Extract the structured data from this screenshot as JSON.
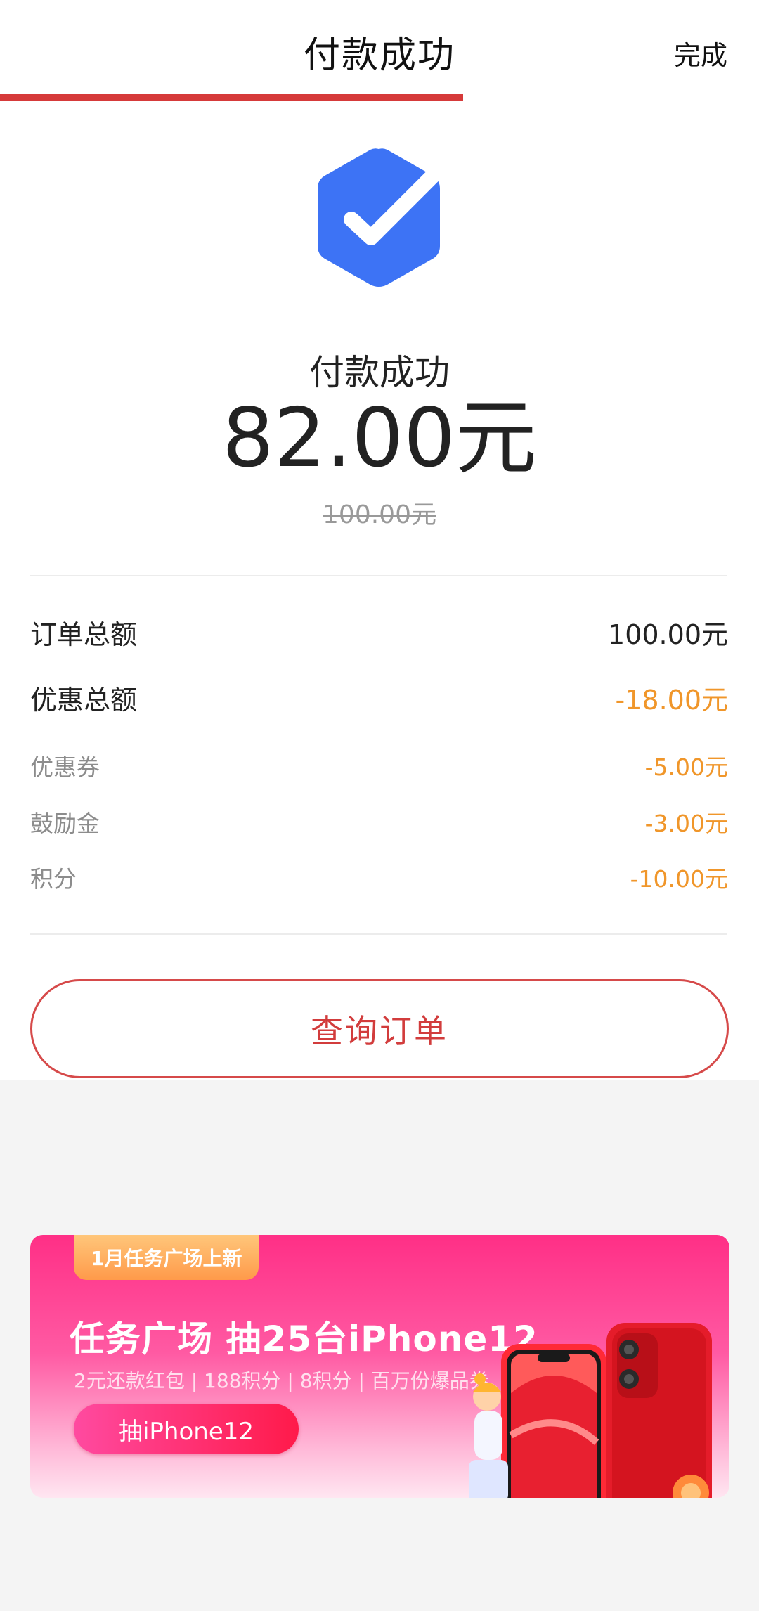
{
  "header": {
    "title": "付款成功",
    "done_label": "完成",
    "progress_fraction": 0.61
  },
  "result": {
    "icon": "check-hexagon-icon",
    "status_label": "付款成功",
    "amount": "82.00元",
    "original_amount": "100.00元"
  },
  "breakdown": {
    "order_total": {
      "label": "订单总额",
      "value": "100.00元"
    },
    "discount_total": {
      "label": "优惠总额",
      "value": "-18.00元"
    },
    "items": [
      {
        "label": "优惠券",
        "value": "-5.00元"
      },
      {
        "label": "鼓励金",
        "value": "-3.00元"
      },
      {
        "label": "积分",
        "value": "-10.00元"
      }
    ]
  },
  "actions": {
    "query_order_label": "查询订单"
  },
  "banner": {
    "tag": "1月任务广场上新",
    "headline": "任务广场 抽25台iPhone12",
    "subline": "2元还款红包 | 188积分 | 8积分 | 百万份爆品券",
    "cta_label": "抽iPhone12"
  },
  "colors": {
    "accent_red": "#d63a3a",
    "icon_blue": "#3d73f5",
    "discount_orange": "#f0962a",
    "banner_pink": "#ff2f86"
  }
}
